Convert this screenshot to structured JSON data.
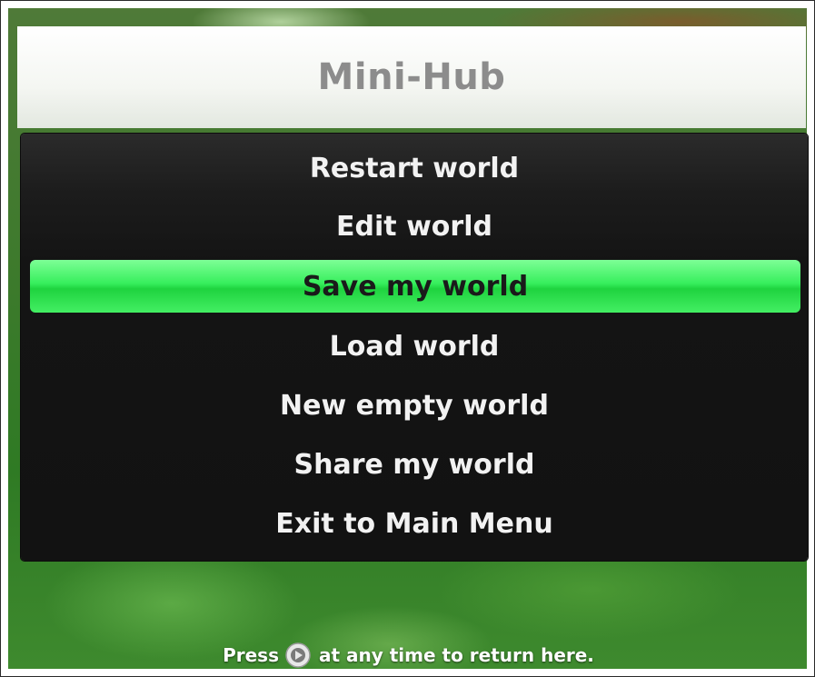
{
  "title": "Mini-Hub",
  "menu": {
    "items": [
      {
        "label": "Restart world"
      },
      {
        "label": "Edit world"
      },
      {
        "label": "Save my world"
      },
      {
        "label": "Load world"
      },
      {
        "label": "New empty world"
      },
      {
        "label": "Share my world"
      },
      {
        "label": "Exit to Main Menu"
      }
    ],
    "selected_index": 2
  },
  "footer": {
    "prefix": "Press",
    "button_icon": "guide-button-icon",
    "suffix": "at any time to return here."
  },
  "colors": {
    "highlight": "#36ee5c",
    "panel": "#141414",
    "title_text": "#8c8c8c"
  }
}
